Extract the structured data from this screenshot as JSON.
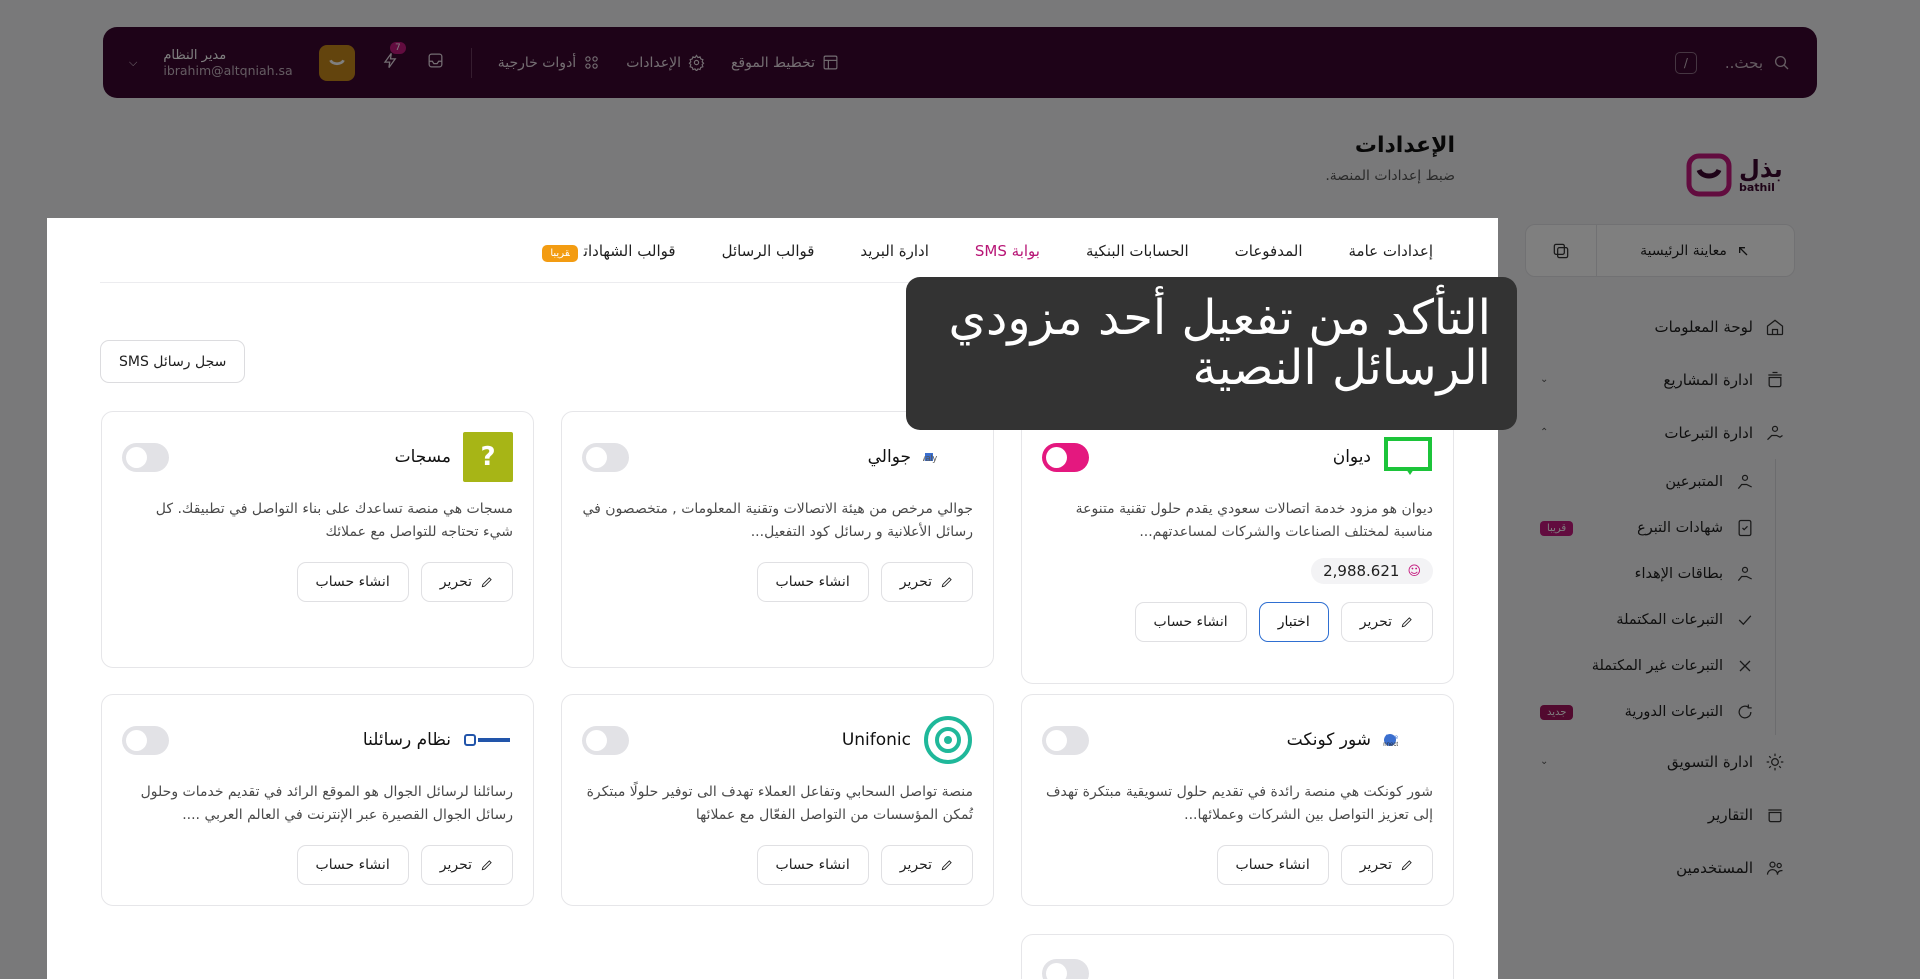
{
  "topbar": {
    "search_placeholder": "بحث..",
    "search_shortcut": "/",
    "nav": [
      "تخطيط الموقع",
      "الإعدادات",
      "أدوات خارجية"
    ],
    "notif_count": "7",
    "user_name": "مدير النظام",
    "user_email": "ibrahim@altqniah.sa"
  },
  "logo": {
    "text": "بذل",
    "sub": "bathil"
  },
  "sidebar": {
    "preview": "معاينة الرئيسية",
    "items": [
      {
        "label": "لوحة المعلومات",
        "icon": "home-icon"
      },
      {
        "label": "ادارة المشاريع",
        "icon": "pot-icon"
      },
      {
        "label": "ادارة التبرعات",
        "icon": "donation-hand-icon"
      }
    ],
    "sub_items": [
      {
        "label": "المتبرعين",
        "icon": "donor-icon",
        "pill": ""
      },
      {
        "label": "شهادات التبرع",
        "icon": "certificate-icon",
        "pill": "قريبا"
      },
      {
        "label": "بطاقات الإهداء",
        "icon": "gift-card-icon",
        "pill": ""
      },
      {
        "label": "التبرعات المكتملة",
        "icon": "check-icon",
        "pill": ""
      },
      {
        "label": "التبرعات غير المكتملة",
        "icon": "x-icon",
        "pill": ""
      },
      {
        "label": "التبرعات الدورية",
        "icon": "refresh-icon",
        "pill": "جديد"
      }
    ],
    "items2": [
      {
        "label": "ادارة التسويق",
        "icon": "marketing-icon"
      },
      {
        "label": "التقارير",
        "icon": "reports-icon"
      },
      {
        "label": "المستخدمين",
        "icon": "users-icon"
      }
    ]
  },
  "page": {
    "title": "الإعدادات",
    "subtitle": "ضبط إعدادات المنصة."
  },
  "tabs": [
    "إعدادات عامة",
    "المدفوعات",
    "الحسابات البنكية",
    "بوابة SMS",
    "ادارة البريد",
    "قوالب الرسائل",
    "قوالب الشهادات"
  ],
  "tab_soon": "قريبا",
  "sms_log": "سجل رسائل SMS",
  "buttons": {
    "edit": "تحرير",
    "create": "انشاء حساب",
    "test": "اختبار"
  },
  "providers": [
    {
      "name": "ديوان",
      "desc": "ديوان هو مزود خدمة اتصالات سعودي يقدم حلول تقنية متنوعة مناسبة لمختلف الصناعات والشركات لمساعدتهم...",
      "balance": "2,988.621",
      "active": true
    },
    {
      "name": "جوالي",
      "desc": "جوالي مرخص من هيئة الاتصالات وتقنية المعلومات , متخصصون في رسائل الأعلانية و رسائل كود التفعيل...",
      "active": false
    },
    {
      "name": "مسجات",
      "desc": "مسجات هي منصة تساعدك على بناء التواصل في تطبيقك. كل شيء تحتاجه للتواصل مع عملائك",
      "active": false
    },
    {
      "name": "شور كونكت",
      "desc": "شور كونكت هي منصة رائدة في تقديم حلول تسويقية مبتكرة تهدف إلى تعزيز التواصل بين الشركات وعملائها...",
      "active": false
    },
    {
      "name": "Unifonic",
      "desc": "منصة تواصل السحابي وتفاعل العملاء تهدف الى توفير حلولًا مبتكرة تُمكن المؤسسات من التواصل الفعّال مع عملائها",
      "active": false
    },
    {
      "name": "نظام رسائلنا",
      "desc": "رسائلنا لرسائل الجوال هو الموقع الرائد في تقديم خدمات وحلول رسائل الجوال القصيرة عبر الإنترنت في العالم العربي ....",
      "active": false
    }
  ],
  "tooltip": "التأكد من تفعيل أحد مزودي الرسائل النصية",
  "colors": {
    "brand": "#3d0630",
    "accent": "#e4187f",
    "tooltip_bg": "#333333"
  }
}
